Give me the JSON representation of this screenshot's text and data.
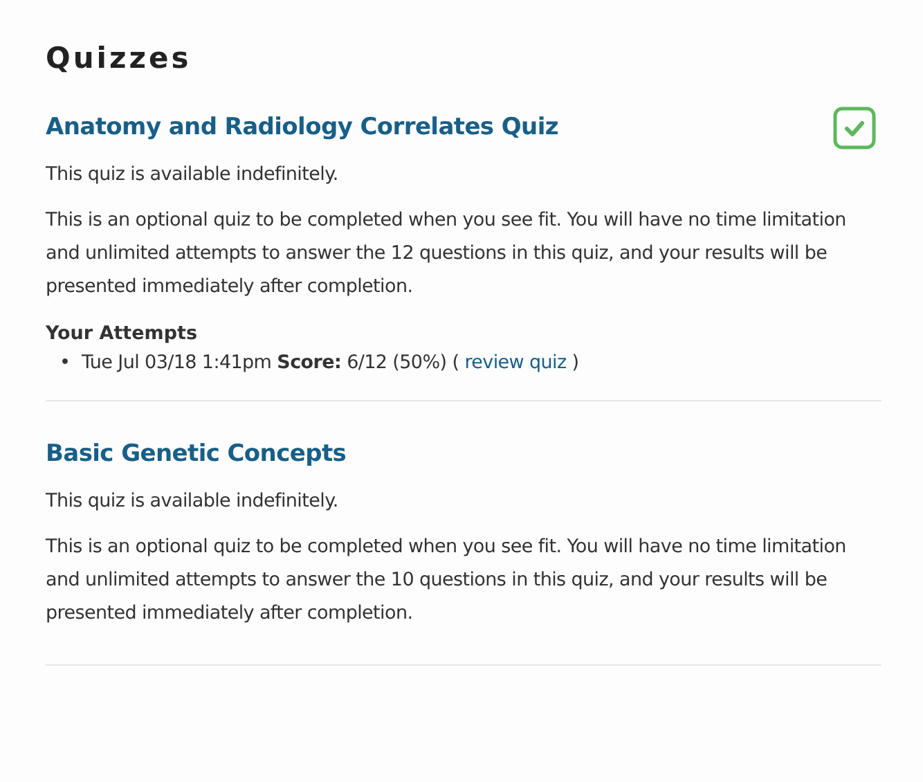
{
  "heading": "Quizzes",
  "quizzes": [
    {
      "title": "Anatomy and Radiology Correlates Quiz",
      "completed": true,
      "availability": "This quiz is available indefinitely.",
      "description": "This is an optional quiz to be completed when you see fit. You will have no time limitation and unlimited attempts to answer the 12 questions in this quiz, and your results will be presented immediately after completion.",
      "attempts_heading": "Your Attempts",
      "attempts": [
        {
          "bullet": "•",
          "text": "Tue Jul 03/18 1:41pm **Score:** 6/12 (50%) (",
          "link": "review quiz",
          "after": ")"
        }
      ]
    },
    {
      "title": "Basic Genetic Concepts",
      "completed": false,
      "availability": "This quiz is available indefinitely.",
      "description": "This is an optional quiz to be completed when you see fit. You will have no time limitation and unlimited attempts to answer the 10 questions in this quiz, and your results will be presented immediately after completion."
    }
  ]
}
